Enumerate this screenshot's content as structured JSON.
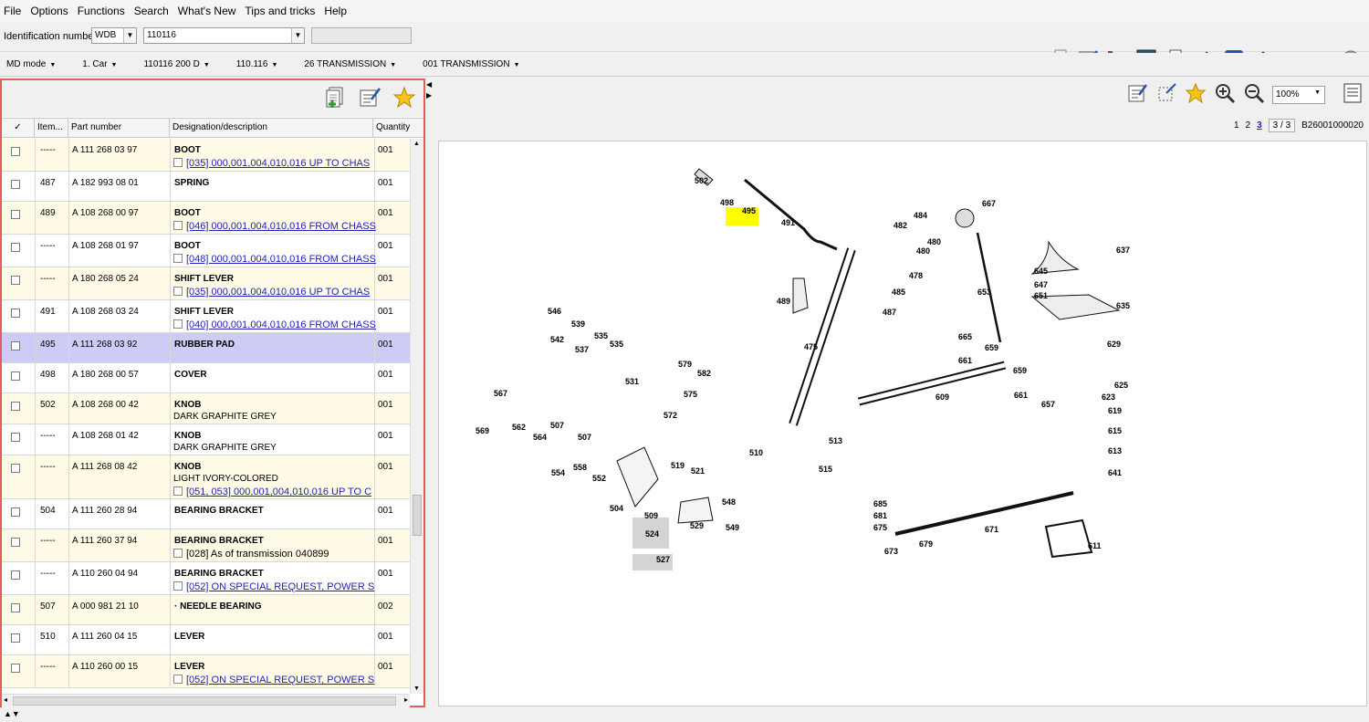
{
  "menu": [
    "File",
    "Options",
    "Functions",
    "Search",
    "What's New",
    "Tips and tricks",
    "Help"
  ],
  "ident": {
    "label": "Identification number",
    "prefix": "WDB",
    "number": "110116"
  },
  "breadcrumb": [
    "MD mode",
    "1. Car",
    "110116 200 D",
    "110.116",
    "26 TRANSMISSION",
    "001 TRANSMISSION"
  ],
  "columns": {
    "check": "✓",
    "item": "Item...",
    "part": "Part number",
    "desc": "Designation/description",
    "qty": "Quantity"
  },
  "rows": [
    {
      "item": "-----",
      "part": "A 111 268 03 97",
      "desc": "BOOT",
      "qty": "001",
      "link": "[035] 000,001,004,010,016 UP TO CHAS",
      "h": 36,
      "odd": true
    },
    {
      "item": "487",
      "part": "A 182 993 08 01",
      "desc": "SPRING",
      "qty": "001",
      "h": 33,
      "odd": false
    },
    {
      "item": "489",
      "part": "A 108 268 00 97",
      "desc": "BOOT",
      "qty": "001",
      "link": "[046] 000,001,004,010,016 FROM CHASS",
      "h": 36,
      "odd": true
    },
    {
      "item": "-----",
      "part": "A 108 268 01 97",
      "desc": "BOOT",
      "qty": "001",
      "link": "[048] 000,001,004,010,016 FROM CHASS",
      "h": 36,
      "odd": false
    },
    {
      "item": "-----",
      "part": "A 180 268 05 24",
      "desc": "SHIFT LEVER",
      "qty": "001",
      "link": "[035] 000,001,004,010,016 UP TO CHAS",
      "h": 36,
      "odd": true
    },
    {
      "item": "491",
      "part": "A 108 268 03 24",
      "desc": "SHIFT LEVER",
      "qty": "001",
      "link": "[040] 000,001,004,010,016 FROM CHASS",
      "h": 36,
      "odd": false
    },
    {
      "item": "495",
      "part": "A 111 268 03 92",
      "desc": "RUBBER PAD",
      "qty": "001",
      "h": 33,
      "sel": true
    },
    {
      "item": "498",
      "part": "A 180 268 00 57",
      "desc": "COVER",
      "qty": "001",
      "h": 33,
      "odd": false
    },
    {
      "item": "502",
      "part": "A 108 268 00 42",
      "desc": "KNOB",
      "qty": "001",
      "sub": "DARK GRAPHITE GREY",
      "h": 34,
      "odd": true
    },
    {
      "item": "-----",
      "part": "A 108 268 01 42",
      "desc": "KNOB",
      "qty": "001",
      "sub": "DARK GRAPHITE GREY",
      "h": 34,
      "odd": false
    },
    {
      "item": "-----",
      "part": "A 111 268 08 42",
      "desc": "KNOB",
      "qty": "001",
      "sub": "LIGHT IVORY-COLORED",
      "link": "[051, 053] 000,001,004,010,016 UP TO C",
      "h": 48,
      "odd": true
    },
    {
      "item": "504",
      "part": "A 111 260 28 94",
      "desc": "BEARING BRACKET",
      "qty": "001",
      "h": 33,
      "odd": false
    },
    {
      "item": "-----",
      "part": "A 111 260 37 94",
      "desc": "BEARING BRACKET",
      "qty": "001",
      "note": "[028] As of transmission 040899",
      "h": 36,
      "odd": true
    },
    {
      "item": "-----",
      "part": "A 110 260 04 94",
      "desc": "BEARING BRACKET",
      "qty": "001",
      "link": "[052] ON SPECIAL REQUEST, POWER S",
      "h": 36,
      "odd": false
    },
    {
      "item": "507",
      "part": "A 000 981 21 10",
      "desc": "· NEEDLE BEARING",
      "qty": "002",
      "h": 33,
      "odd": true
    },
    {
      "item": "510",
      "part": "A 111 260 04 15",
      "desc": "LEVER",
      "qty": "001",
      "h": 33,
      "odd": false
    },
    {
      "item": "-----",
      "part": "A 110 260 00 15",
      "desc": "LEVER",
      "qty": "001",
      "link": "[052] ON SPECIAL REQUEST, POWER S",
      "h": 36,
      "odd": true
    }
  ],
  "viewer": {
    "zoom": "100%",
    "pages": [
      "1",
      "2",
      "3"
    ],
    "current": "3",
    "pager": "3 / 3",
    "doc_id": "B26001000020"
  },
  "diagram_labels": [
    "502",
    "498",
    "495",
    "491",
    "489",
    "484",
    "482",
    "480",
    "480",
    "478",
    "485",
    "487",
    "475",
    "667",
    "637",
    "645",
    "647",
    "651",
    "635",
    "653",
    "665",
    "659",
    "661",
    "629",
    "609",
    "659",
    "661",
    "657",
    "625",
    "623",
    "619",
    "615",
    "613",
    "641",
    "546",
    "539",
    "542",
    "535",
    "537",
    "535",
    "531",
    "579",
    "582",
    "575",
    "572",
    "567",
    "569",
    "562",
    "564",
    "507",
    "507",
    "554",
    "558",
    "552",
    "519",
    "521",
    "504",
    "509",
    "524",
    "527",
    "529",
    "548",
    "549",
    "510",
    "513",
    "515",
    "685",
    "681",
    "675",
    "673",
    "679",
    "671",
    "611"
  ],
  "colors": {
    "highlight": "#ffff00",
    "selected_row": "#ccccf5",
    "odd_row": "#fffbe6",
    "link": "#2222bb",
    "pane_border": "#e06060"
  }
}
